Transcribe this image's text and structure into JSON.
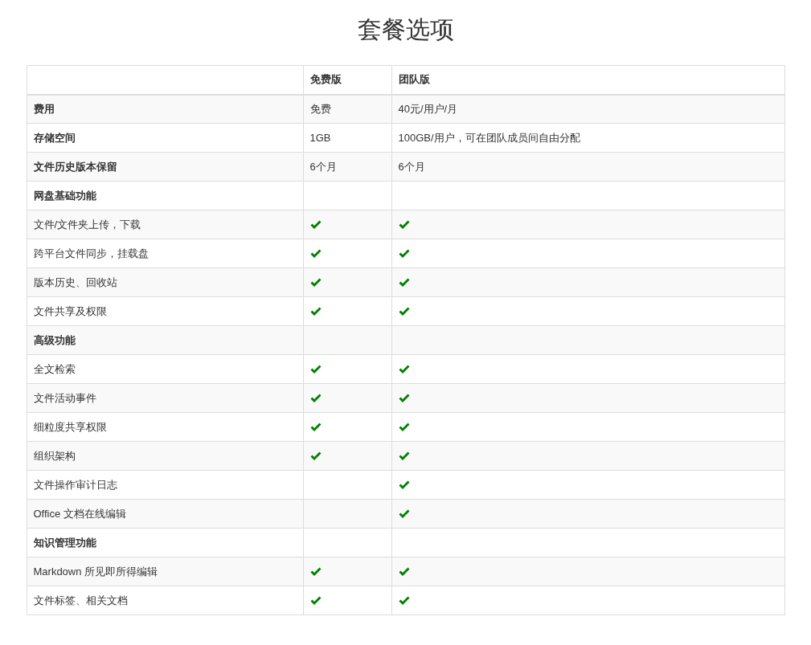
{
  "title": "套餐选项",
  "table": {
    "columns": [
      "",
      "免费版",
      "团队版"
    ],
    "rows": [
      {
        "kind": "info",
        "label": "费用",
        "free": "免费",
        "team": "40元/用户/月"
      },
      {
        "kind": "info",
        "label": "存储空间",
        "free": "1GB",
        "team": "100GB/用户，可在团队成员间自由分配"
      },
      {
        "kind": "info",
        "label": "文件历史版本保留",
        "free": "6个月",
        "team": "6个月"
      },
      {
        "kind": "section",
        "label": "网盘基础功能"
      },
      {
        "kind": "feature",
        "label": "文件/文件夹上传，下载",
        "free": true,
        "team": true
      },
      {
        "kind": "feature",
        "label": "跨平台文件同步，挂载盘",
        "free": true,
        "team": true
      },
      {
        "kind": "feature",
        "label": "版本历史、回收站",
        "free": true,
        "team": true
      },
      {
        "kind": "feature",
        "label": "文件共享及权限",
        "free": true,
        "team": true
      },
      {
        "kind": "section",
        "label": "高级功能"
      },
      {
        "kind": "feature",
        "label": "全文检索",
        "free": true,
        "team": true
      },
      {
        "kind": "feature",
        "label": "文件活动事件",
        "free": true,
        "team": true
      },
      {
        "kind": "feature",
        "label": "细粒度共享权限",
        "free": true,
        "team": true
      },
      {
        "kind": "feature",
        "label": "组织架构",
        "free": true,
        "team": true
      },
      {
        "kind": "feature",
        "label": "文件操作审计日志",
        "free": false,
        "team": true
      },
      {
        "kind": "feature",
        "label": "Office 文档在线编辑",
        "free": false,
        "team": true
      },
      {
        "kind": "section",
        "label": "知识管理功能"
      },
      {
        "kind": "feature",
        "label": "Markdown 所见即所得编辑",
        "free": true,
        "team": true
      },
      {
        "kind": "feature",
        "label": "文件标签、相关文档",
        "free": true,
        "team": true
      }
    ]
  }
}
